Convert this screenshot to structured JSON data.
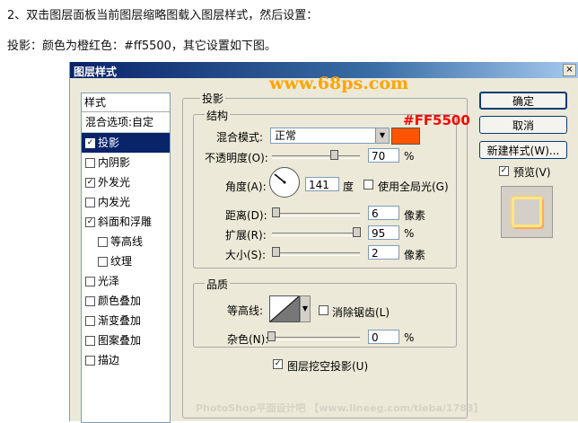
{
  "intro": {
    "line1": "2、双击图层面板当前图层缩略图载入图层样式，然后设置：",
    "line2": "投影：颜色为橙红色：#ff5500，其它设置如下图。"
  },
  "dialog": {
    "title": "图层样式",
    "close": "×"
  },
  "style_list": {
    "header": "样式",
    "blend": "混合选项:自定",
    "items": [
      {
        "label": "投影",
        "checked": true
      },
      {
        "label": "内阴影",
        "checked": false
      },
      {
        "label": "外发光",
        "checked": true
      },
      {
        "label": "内发光",
        "checked": false
      },
      {
        "label": "斜面和浮雕",
        "checked": true
      },
      {
        "label": "等高线",
        "checked": false
      },
      {
        "label": "纹理",
        "checked": false
      },
      {
        "label": "光泽",
        "checked": false
      },
      {
        "label": "颜色叠加",
        "checked": false
      },
      {
        "label": "渐变叠加",
        "checked": false
      },
      {
        "label": "图案叠加",
        "checked": false
      },
      {
        "label": "描边",
        "checked": false
      }
    ]
  },
  "shadow": {
    "title": "投影",
    "structure_title": "结构",
    "blend_mode_label": "混合模式:",
    "blend_mode_value": "正常",
    "opacity_label": "不透明度(O):",
    "opacity_value": "70",
    "angle_label": "角度(A):",
    "angle_value": "141",
    "angle_unit": "度",
    "global_light_label": "使用全局光(G)",
    "distance_label": "距离(D):",
    "distance_value": "6",
    "spread_label": "扩展(R):",
    "spread_value": "95",
    "size_label": "大小(S):",
    "size_value": "2",
    "px_unit": "像素",
    "pct_unit": "%",
    "color": "#ff5500",
    "color_label": "#FF5500",
    "quality_title": "品质",
    "contour_label": "等高线:",
    "anti_alias_label": "消除锯齿(L)",
    "noise_label": "杂色(N):",
    "noise_value": "0",
    "knockout_label": "图层挖空投影(U)"
  },
  "buttons": {
    "ok": "确定",
    "cancel": "取消",
    "new_style": "新建样式(W)...",
    "preview": "预览(V)"
  },
  "watermarks": {
    "top": "www.68ps.com",
    "bottom": "PhotoShop平面设计吧 【www.lineeg.com/tieba/1783】"
  }
}
